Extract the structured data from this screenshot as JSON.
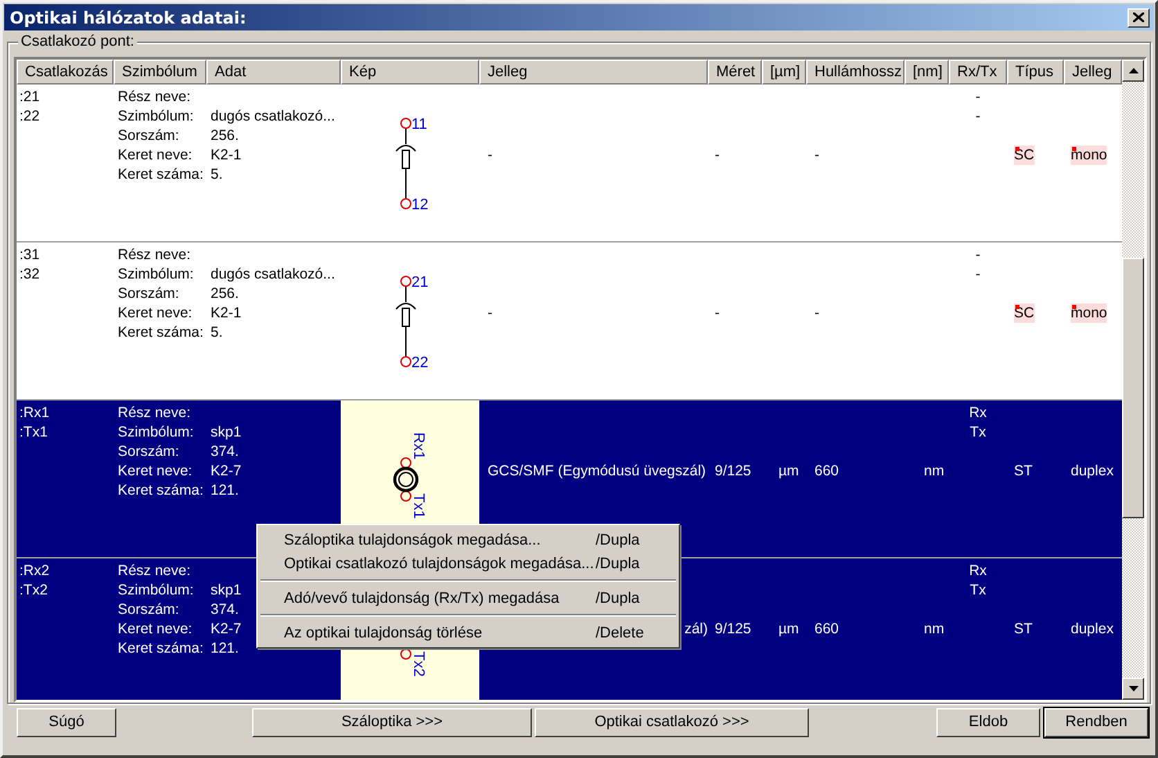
{
  "window": {
    "title": "Optikai hálózatok adatai:"
  },
  "group": {
    "label": "Csatlakozó pont:"
  },
  "table": {
    "columns": [
      "Csatlakozás",
      "Szimbólum",
      "Adat",
      "Kép",
      "Jelleg",
      "Méret",
      "[µm]",
      "Hullámhossz",
      "[nm]",
      "Rx/Tx",
      "Típus",
      "Jelleg"
    ],
    "rows": [
      {
        "selected": false,
        "connections": [
          ":21",
          ":22"
        ],
        "fields": [
          {
            "label": "Rész neve:"
          },
          {
            "label": "Szimbólum:",
            "value": "dugós csatlakozó..."
          },
          {
            "label": "Sorszám:",
            "value": "256."
          },
          {
            "label": "Keret neve:",
            "value": "K2-1"
          },
          {
            "label": "Keret száma:",
            "value": "5."
          }
        ],
        "picture": {
          "kind": "plug",
          "top_label": "11",
          "bottom_label": "12"
        },
        "jelleg": "-",
        "meret": "-",
        "hullamhossz": "-",
        "rx_tx": [
          "-",
          "-"
        ],
        "tipus": {
          "text": "SC",
          "highlighted": true
        },
        "jelleg_2": {
          "text": "mono",
          "highlighted": true
        }
      },
      {
        "selected": false,
        "connections": [
          ":31",
          ":32"
        ],
        "fields": [
          {
            "label": "Rész neve:"
          },
          {
            "label": "Szimbólum:",
            "value": "dugós csatlakozó..."
          },
          {
            "label": "Sorszám:",
            "value": "256."
          },
          {
            "label": "Keret neve:",
            "value": "K2-1"
          },
          {
            "label": "Keret száma:",
            "value": "5."
          }
        ],
        "picture": {
          "kind": "plug",
          "top_label": "21",
          "bottom_label": "22"
        },
        "jelleg": "-",
        "meret": "-",
        "hullamhossz": "-",
        "rx_tx": [
          "-",
          "-"
        ],
        "tipus": {
          "text": "SC",
          "highlighted": true
        },
        "jelleg_2": {
          "text": "mono",
          "highlighted": true
        }
      },
      {
        "selected": true,
        "connections": [
          ":Rx1",
          ":Tx1"
        ],
        "fields": [
          {
            "label": "Rész neve:"
          },
          {
            "label": "Szimbólum:",
            "value": "skp1"
          },
          {
            "label": "Sorszám:",
            "value": "374."
          },
          {
            "label": "Keret neve:",
            "value": "K2-7"
          },
          {
            "label": "Keret száma:",
            "value": "121."
          }
        ],
        "picture": {
          "kind": "transceiver",
          "top_label": "Rx1",
          "bottom_label": "Tx1"
        },
        "jelleg": "GCS/SMF (Egymódusú üvegszál)",
        "meret": "9/125",
        "meret_unit": "µm",
        "hullamhossz": "660",
        "hullamhossz_unit": "nm",
        "rx_tx": [
          "Rx",
          "Tx"
        ],
        "tipus": {
          "text": "ST",
          "highlighted": false
        },
        "jelleg_2": {
          "text": "duplex",
          "highlighted": false
        }
      },
      {
        "selected": true,
        "connections": [
          ":Rx2",
          ":Tx2"
        ],
        "fields": [
          {
            "label": "Rész neve:"
          },
          {
            "label": "Szimbólum:",
            "value": "skp1"
          },
          {
            "label": "Sorszám:",
            "value": "374."
          },
          {
            "label": "Keret neve:",
            "value": "K2-7"
          },
          {
            "label": "Keret száma:",
            "value": "121."
          }
        ],
        "picture": {
          "kind": "transceiver",
          "bottom_label": "Tx2"
        },
        "jelleg": "zál)",
        "jelleg_partly_hidden": true,
        "meret": "9/125",
        "meret_unit": "µm",
        "hullamhossz": "660",
        "hullamhossz_unit": "nm",
        "rx_tx": [
          "Rx",
          "Tx"
        ],
        "tipus": {
          "text": "ST",
          "highlighted": false
        },
        "jelleg_2": {
          "text": "duplex",
          "highlighted": false
        }
      }
    ]
  },
  "context_menu": [
    {
      "kind": "item",
      "label": "Száloptika tulajdonságok megadása...",
      "shortcut": "/Dupla"
    },
    {
      "kind": "item",
      "label": "Optikai csatlakozó tulajdonságok megadása...",
      "shortcut": "/Dupla"
    },
    {
      "kind": "separator"
    },
    {
      "kind": "item",
      "label": "Adó/vevő tulajdonság (Rx/Tx) megadása",
      "shortcut": "/Dupla"
    },
    {
      "kind": "separator"
    },
    {
      "kind": "item",
      "label": "Az optikai tulajdonság törlése",
      "shortcut": "/Delete"
    }
  ],
  "buttons": [
    {
      "label": "Súgó",
      "default": false
    },
    {
      "label": "Száloptika >>>",
      "default": false
    },
    {
      "label": "Optikai csatlakozó >>>",
      "default": false
    },
    {
      "label": "Eldob",
      "default": false
    },
    {
      "label": "Rendben",
      "default": true
    }
  ]
}
